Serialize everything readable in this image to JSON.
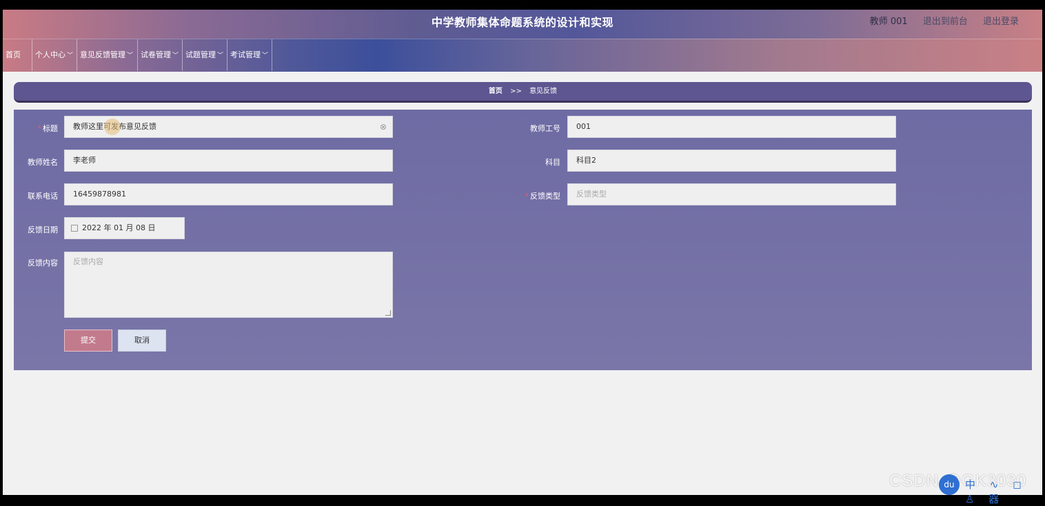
{
  "header": {
    "title": "中学教师集体命题系统的设计和实现",
    "user": "教师 001",
    "links": [
      "退出到前台",
      "退出登录"
    ]
  },
  "nav": {
    "items": [
      "首页",
      "个人中心",
      "意见反馈管理",
      "试卷管理",
      "试题管理",
      "考试管理"
    ]
  },
  "breadcrumb": {
    "home": "首页",
    "sep": ">>",
    "current": "意见反馈"
  },
  "form": {
    "title": {
      "label": "标题",
      "value": "教师这里可发布意见反馈"
    },
    "teacher_no": {
      "label": "教师工号",
      "value": "001"
    },
    "teacher_name": {
      "label": "教师姓名",
      "value": "李老师"
    },
    "subject": {
      "label": "科目",
      "value": "科目2"
    },
    "phone": {
      "label": "联系电话",
      "value": "16459878981"
    },
    "feedback_type": {
      "label": "反馈类型",
      "placeholder": "反馈类型"
    },
    "feedback_date": {
      "label": "反馈日期",
      "value": "2022 年 01 月 08 日"
    },
    "feedback_content": {
      "label": "反馈内容",
      "placeholder": "反馈内容"
    },
    "submit": "提交",
    "cancel": "取消"
  },
  "watermark": "CSDN @GK3030",
  "overlay": {
    "badge_text": "du",
    "tool_icons": "中 ∿ ◻ ♙ 器"
  },
  "colors": {
    "accent_submit": "#c27b8c",
    "panel": "#726fa6",
    "required": "#e25a6a"
  }
}
